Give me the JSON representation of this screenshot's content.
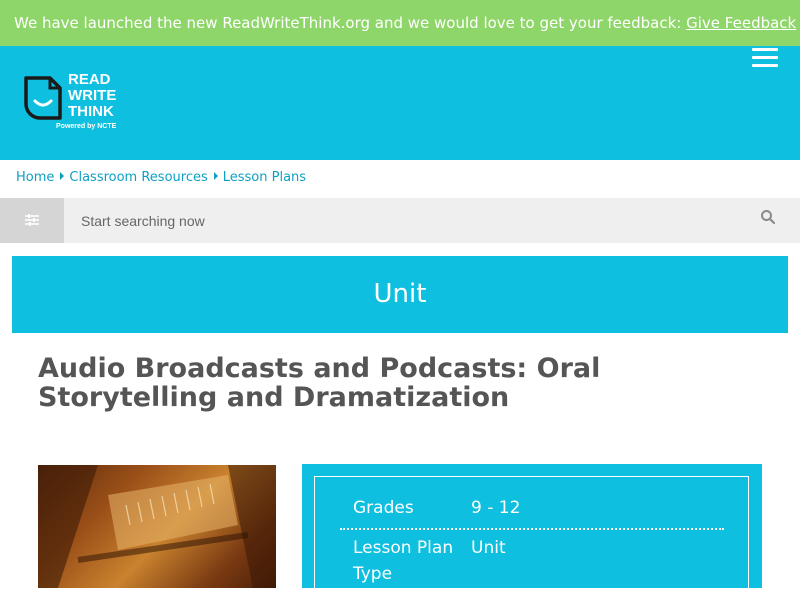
{
  "banner": {
    "text": "We have launched the new ReadWriteThink.org and we would love to get your feedback:",
    "link": "Give Feedback"
  },
  "logo": {
    "line1": "READ",
    "line2": "WRITE",
    "line3": "THINK",
    "tagline": "Powered by NCTE"
  },
  "breadcrumb": [
    "Home",
    "Classroom Resources",
    "Lesson Plans"
  ],
  "search": {
    "placeholder": "Start searching now"
  },
  "resource_type": "Unit",
  "title": "Audio Broadcasts and Podcasts: Oral Storytelling and Dramatization",
  "details": {
    "grades_label": "Grades",
    "grades_value": "9 - 12",
    "type_label": "Lesson Plan Type",
    "type_value": "Unit"
  },
  "colors": {
    "banner": "#8fd66a",
    "brand": "#0ebfdf",
    "link": "#0d9fc4",
    "title": "#555555"
  },
  "icons": [
    "menu-icon",
    "filter-icon",
    "search-icon",
    "logo-doc-icon"
  ]
}
